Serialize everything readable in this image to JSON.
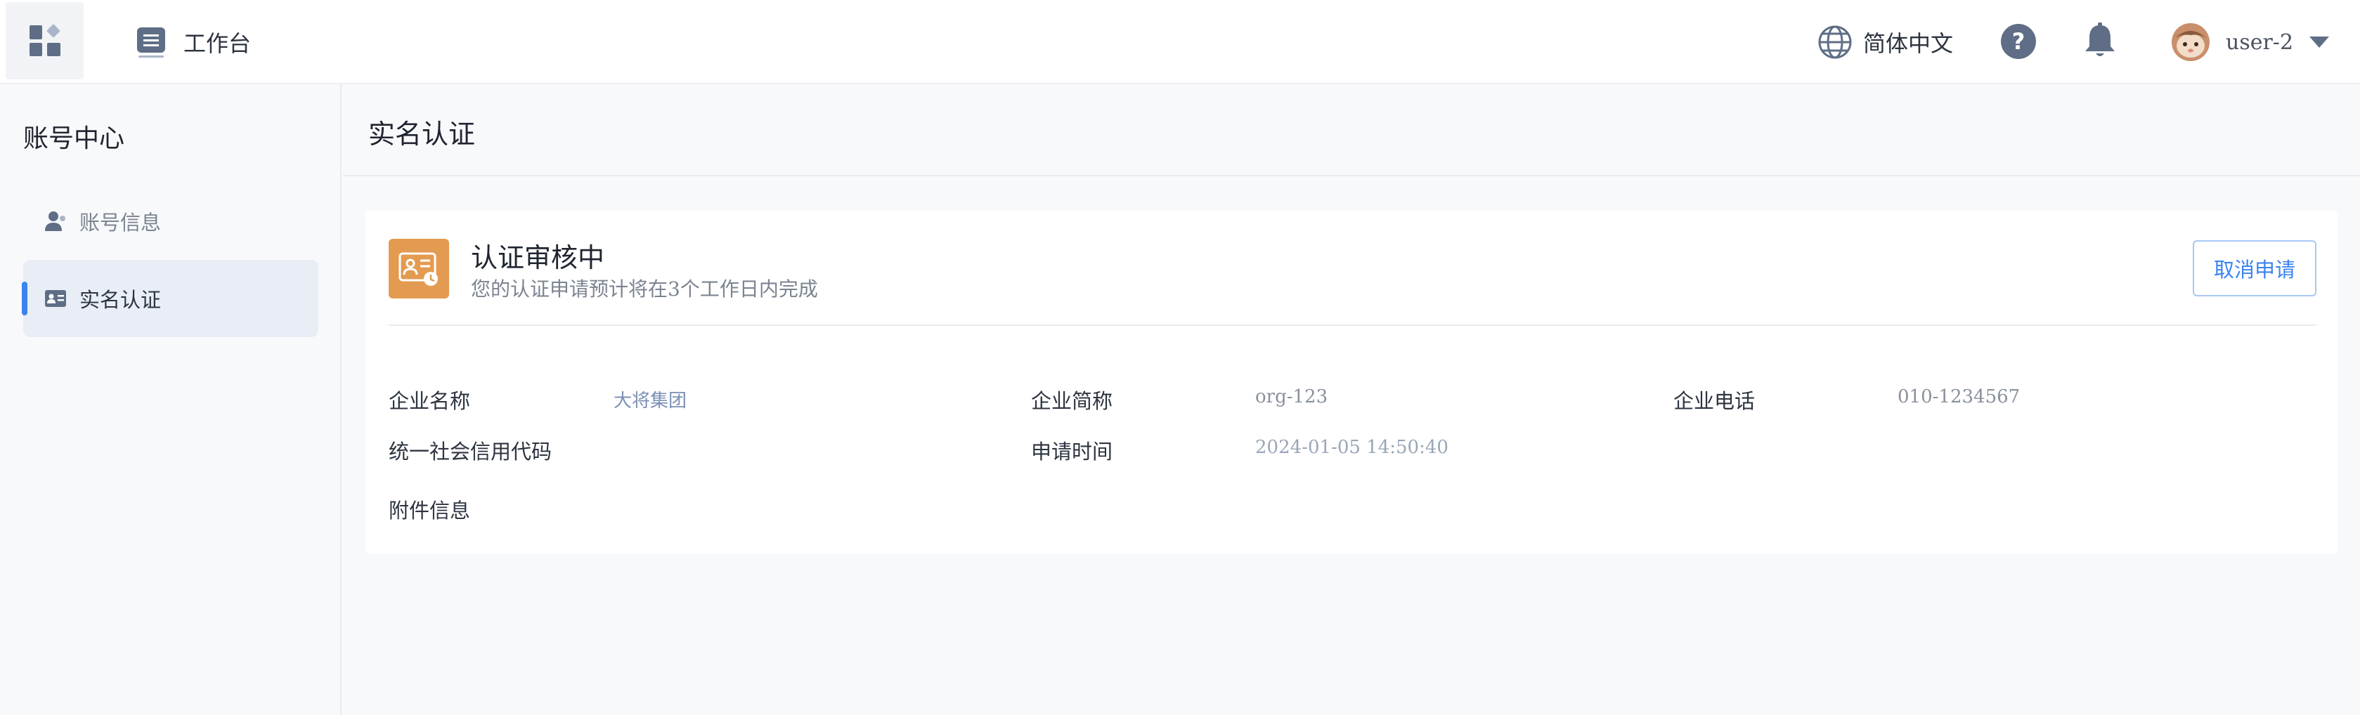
{
  "header": {
    "workbench_label": "工作台",
    "language_label": "简体中文",
    "user_name": "user-2"
  },
  "sidebar": {
    "title": "账号中心",
    "items": [
      {
        "label": "账号信息",
        "icon": "user-icon",
        "active": false
      },
      {
        "label": "实名认证",
        "icon": "id-card-icon",
        "active": true
      }
    ]
  },
  "main": {
    "page_title": "实名认证",
    "status": {
      "title": "认证审核中",
      "description": "您的认证申请预计将在3个工作日内完成",
      "icon": "id-card-clock-icon",
      "icon_color": "#e39b51"
    },
    "cancel_button_label": "取消申请",
    "fields": {
      "company_name_label": "企业名称",
      "company_name_value": "大将集团",
      "company_short_label": "企业简称",
      "company_short_value": "org-123",
      "company_phone_label": "企业电话",
      "company_phone_value": "010-1234567",
      "credit_code_label": "统一社会信用代码",
      "apply_time_label": "申请时间",
      "apply_time_value": "2024-01-05 14:50:40",
      "attachment_label": "附件信息"
    }
  },
  "colors": {
    "accent": "#3b83f0",
    "header_bg": "#ffffff",
    "page_bg": "#f8f9fb",
    "active_item_bg": "#e9eef6"
  }
}
